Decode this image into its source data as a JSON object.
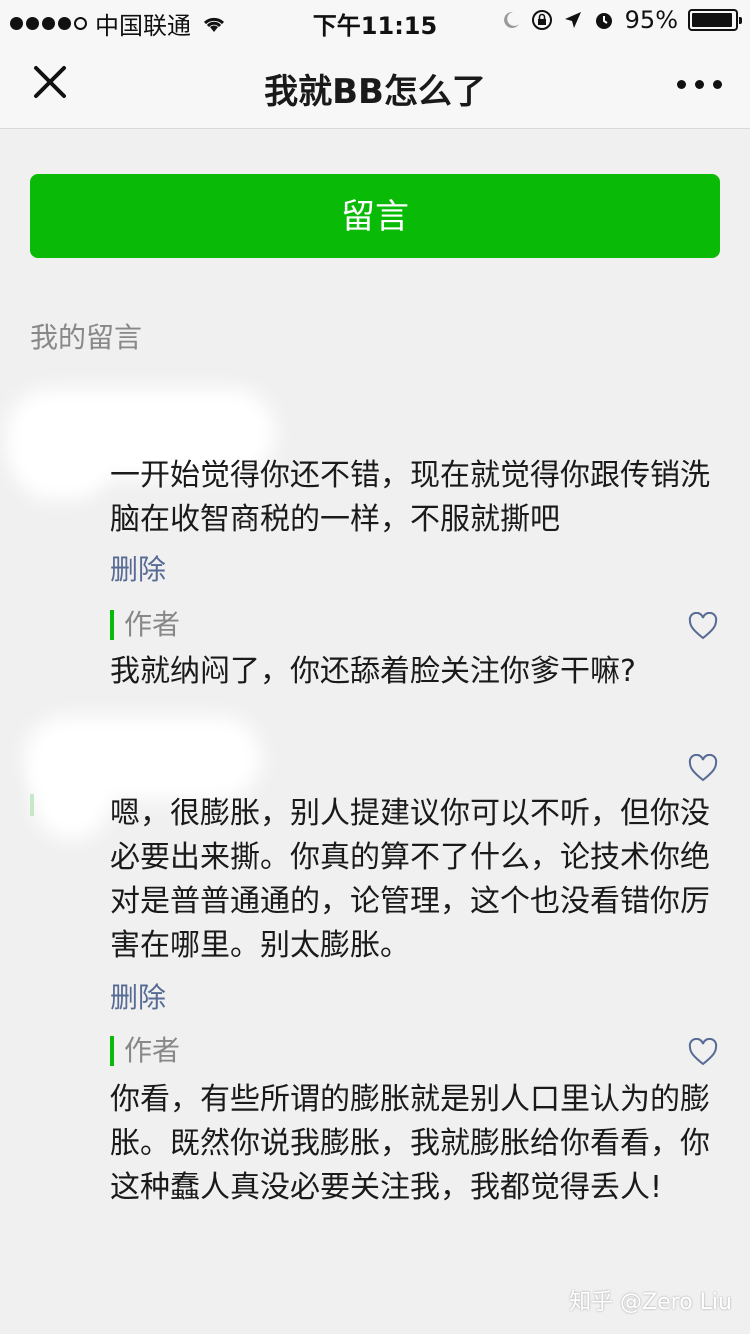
{
  "status_bar": {
    "carrier": "中国联通",
    "time": "下午11:15",
    "battery_percent_label": "95%",
    "battery_level": 0.95
  },
  "nav": {
    "title": "我就BB怎么了",
    "close_icon": "close-icon",
    "more_icon": "more-icon"
  },
  "accent_color": "#09bb07",
  "link_color": "#576b95",
  "leave_button_label": "留言",
  "section_label": "我的留言",
  "comments": [
    {
      "text": "一开始觉得你还不错，现在就觉得你跟传销洗脑在收智商税的一样，不服就撕吧",
      "delete_label": "删除",
      "reply": {
        "author_label": "作者",
        "text": "我就纳闷了，你还舔着脸关注你爹干嘛?"
      }
    },
    {
      "text": "嗯，很膨胀，别人提建议你可以不听，但你没必要出来撕。你真的算不了什么，论技术你绝对是普普通通的，论管理，这个也没看错你厉害在哪里。别太膨胀。",
      "delete_label": "删除",
      "reply": {
        "author_label": "作者",
        "text": "你看，有些所谓的膨胀就是别人口里认为的膨胀。既然你说我膨胀，我就膨胀给你看看，你这种蠢人真没必要关注我，我都觉得丢人!"
      }
    }
  ],
  "watermark": "知乎 @Zero Liu"
}
